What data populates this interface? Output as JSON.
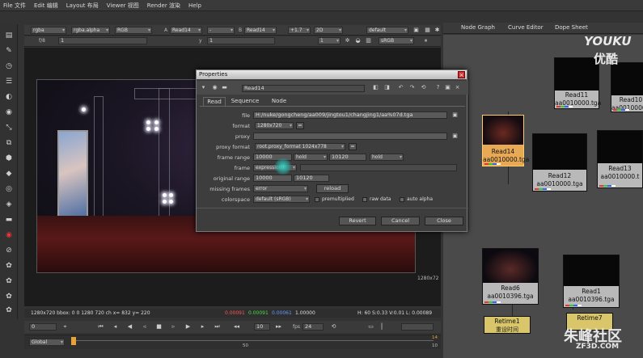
{
  "menu": [
    "File 文件",
    "Edit 编辑",
    "Layout 布局",
    "Viewer 视图",
    "Render 渲染",
    "Help"
  ],
  "viewer_controls": {
    "channels": "rgba",
    "alpha": "rgba.alpha",
    "colorspace": "RGB",
    "a_label": "A",
    "a_input": "Read14",
    "a_op": "-",
    "b_label": "B",
    "b_input": "Read14",
    "gain": "+1.7",
    "mode": "2D",
    "lut": "default",
    "fstop": "f/8",
    "frame_field": "1",
    "y_label": "y",
    "y_value": "1",
    "proxy": "1",
    "display": "sRGB"
  },
  "viewer_info": {
    "format_label": "1280x72",
    "status": "1280x720  bbox: 0 0 1280 720  ch  x= 832 y= 220",
    "r": "0.00091",
    "g": "0.00091",
    "b": "0.00061",
    "a": "1.00000",
    "hsvl": "H: 60 S:0.33 V:0.01  L: 0.00089"
  },
  "playback": {
    "frame": "0",
    "step": "10",
    "fps_label": "fps",
    "fps": "24",
    "range": "Global",
    "tick_mid": "50",
    "tick_end": "10",
    "end_top": "14"
  },
  "node_graph": {
    "tabs": [
      "Node Graph",
      "Curve Editor",
      "Dope Sheet"
    ],
    "nodes": [
      {
        "name": "Read11",
        "file": "aa0010000.tga"
      },
      {
        "name": "Read10",
        "file": "aa0010000.t"
      },
      {
        "name": "Read14",
        "file": "aa0010000.tga"
      },
      {
        "name": "Read12",
        "file": "aa0010000.tga"
      },
      {
        "name": "Read13",
        "file": "aa0010000.t"
      },
      {
        "name": "Read6",
        "file": "aa0010396.tga"
      },
      {
        "name": "Read1",
        "file": "aa0010396.tga"
      }
    ],
    "retimes": [
      {
        "name": "Retime1",
        "sub": "重设时间"
      },
      {
        "name": "Retime7",
        "sub": ""
      }
    ]
  },
  "properties": {
    "title": "Properties",
    "node_name": "Read14",
    "tabs": [
      "Read",
      "Sequence",
      "Node"
    ],
    "labels": {
      "file": "file",
      "format": "format",
      "proxy": "proxy",
      "proxy_format": "proxy format",
      "frame_range": "frame range",
      "frame": "frame",
      "original_range": "original range",
      "missing_frames": "missing frames",
      "colorspace": "colorspace"
    },
    "values": {
      "file": "H:/nuke/gongcheng/aa009/jingtou1/changjing1/aa%07d.tga",
      "format": "1280x720",
      "proxy": "",
      "proxy_format": "root.proxy_format 1024x778",
      "first": "10000",
      "before": "hold",
      "last": "10120",
      "after": "hold",
      "frame_mode": "expression",
      "frame": "",
      "orig_first": "10000",
      "orig_last": "10120",
      "missing": "error",
      "reload": "reload",
      "colorspace": "default (sRGB)",
      "premultiplied": "premultiplied",
      "raw": "raw data",
      "auto_alpha": "auto alpha"
    },
    "buttons": {
      "revert": "Revert",
      "cancel": "Cancel",
      "close": "Close"
    }
  },
  "watermarks": {
    "youku": "YOUKU",
    "youku_cn": "优酷",
    "zf3d": "朱峰社区",
    "zf3d_url": "ZF3D.COM"
  }
}
